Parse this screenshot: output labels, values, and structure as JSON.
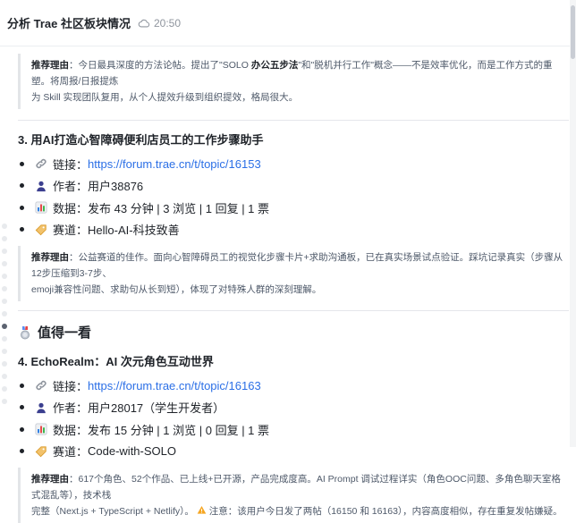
{
  "header": {
    "title": "分析 Trae 社区板块情况",
    "time": "20:50"
  },
  "quote1": {
    "label": "推荐理由",
    "t1": "：今日最具深度的方法论帖。提出了\"SOLO ",
    "bold": "办公五步法",
    "t2": "\"和\"脱机并行工作\"概念——不是效率优化，而是工作方式的重塑。将周报/日报提炼",
    "line2": "为 Skill 实现团队复用，从个人提效升级到组织提效，格局很大。"
  },
  "topic3": {
    "title": "3. 用AI打造心智障碍便利店员工的工作步骤助手",
    "link_label": "链接：",
    "link_url": "https://forum.trae.cn/t/topic/16153",
    "author_label": "作者：",
    "author": "用户38876",
    "data_label": "数据：",
    "data": "发布 43 分钟 | 3 浏览 | 1 回复 | 1 票",
    "track_label": "赛道：",
    "track": "Hello-AI-科技致善",
    "reason_label": "推荐理由",
    "reason1": "：公益赛道的佳作。面向心智障碍员工的视觉化步骤卡片+求助沟通板，已在真实场景试点验证。踩坑记录真实（步骤从12步压缩到3-7步、",
    "reason2": "emoji兼容性问题、求助句从长到短），体现了对特殊人群的深刻理解。"
  },
  "section": {
    "title": "值得一看"
  },
  "topic4": {
    "title": "4. EchoRealm：AI 次元角色互动世界",
    "link_label": "链接：",
    "link_url": "https://forum.trae.cn/t/topic/16163",
    "author_label": "作者：",
    "author": "用户28017（学生开发者）",
    "data_label": "数据：",
    "data": "发布 15 分钟 | 1 浏览 | 0 回复 | 1 票",
    "track_label": "赛道：",
    "track": "Code-with-SOLO",
    "reason_label": "推荐理由",
    "reason1": "：617个角色、52个作品、已上线+已开源，产品完成度高。AI Prompt 调试过程详实（角色OOC问题、多角色聊天室格式混乱等），技术栈",
    "reason2a": "完整（Next.js + TypeScript + Netlify）。",
    "reason2b": "注意：该用户今日发了两帖（16150 和 16163），内容高度相似，存在重复发帖嫌疑。"
  },
  "icons": {
    "link": "link-icon",
    "author": "person-icon",
    "data": "bar-chart-icon",
    "track": "tag-icon",
    "medal": "medal-icon",
    "warning": "warning-icon",
    "cloud": "cloud-icon"
  },
  "colors": {
    "link": "#2b6fe6",
    "warning": "#f5a623"
  }
}
